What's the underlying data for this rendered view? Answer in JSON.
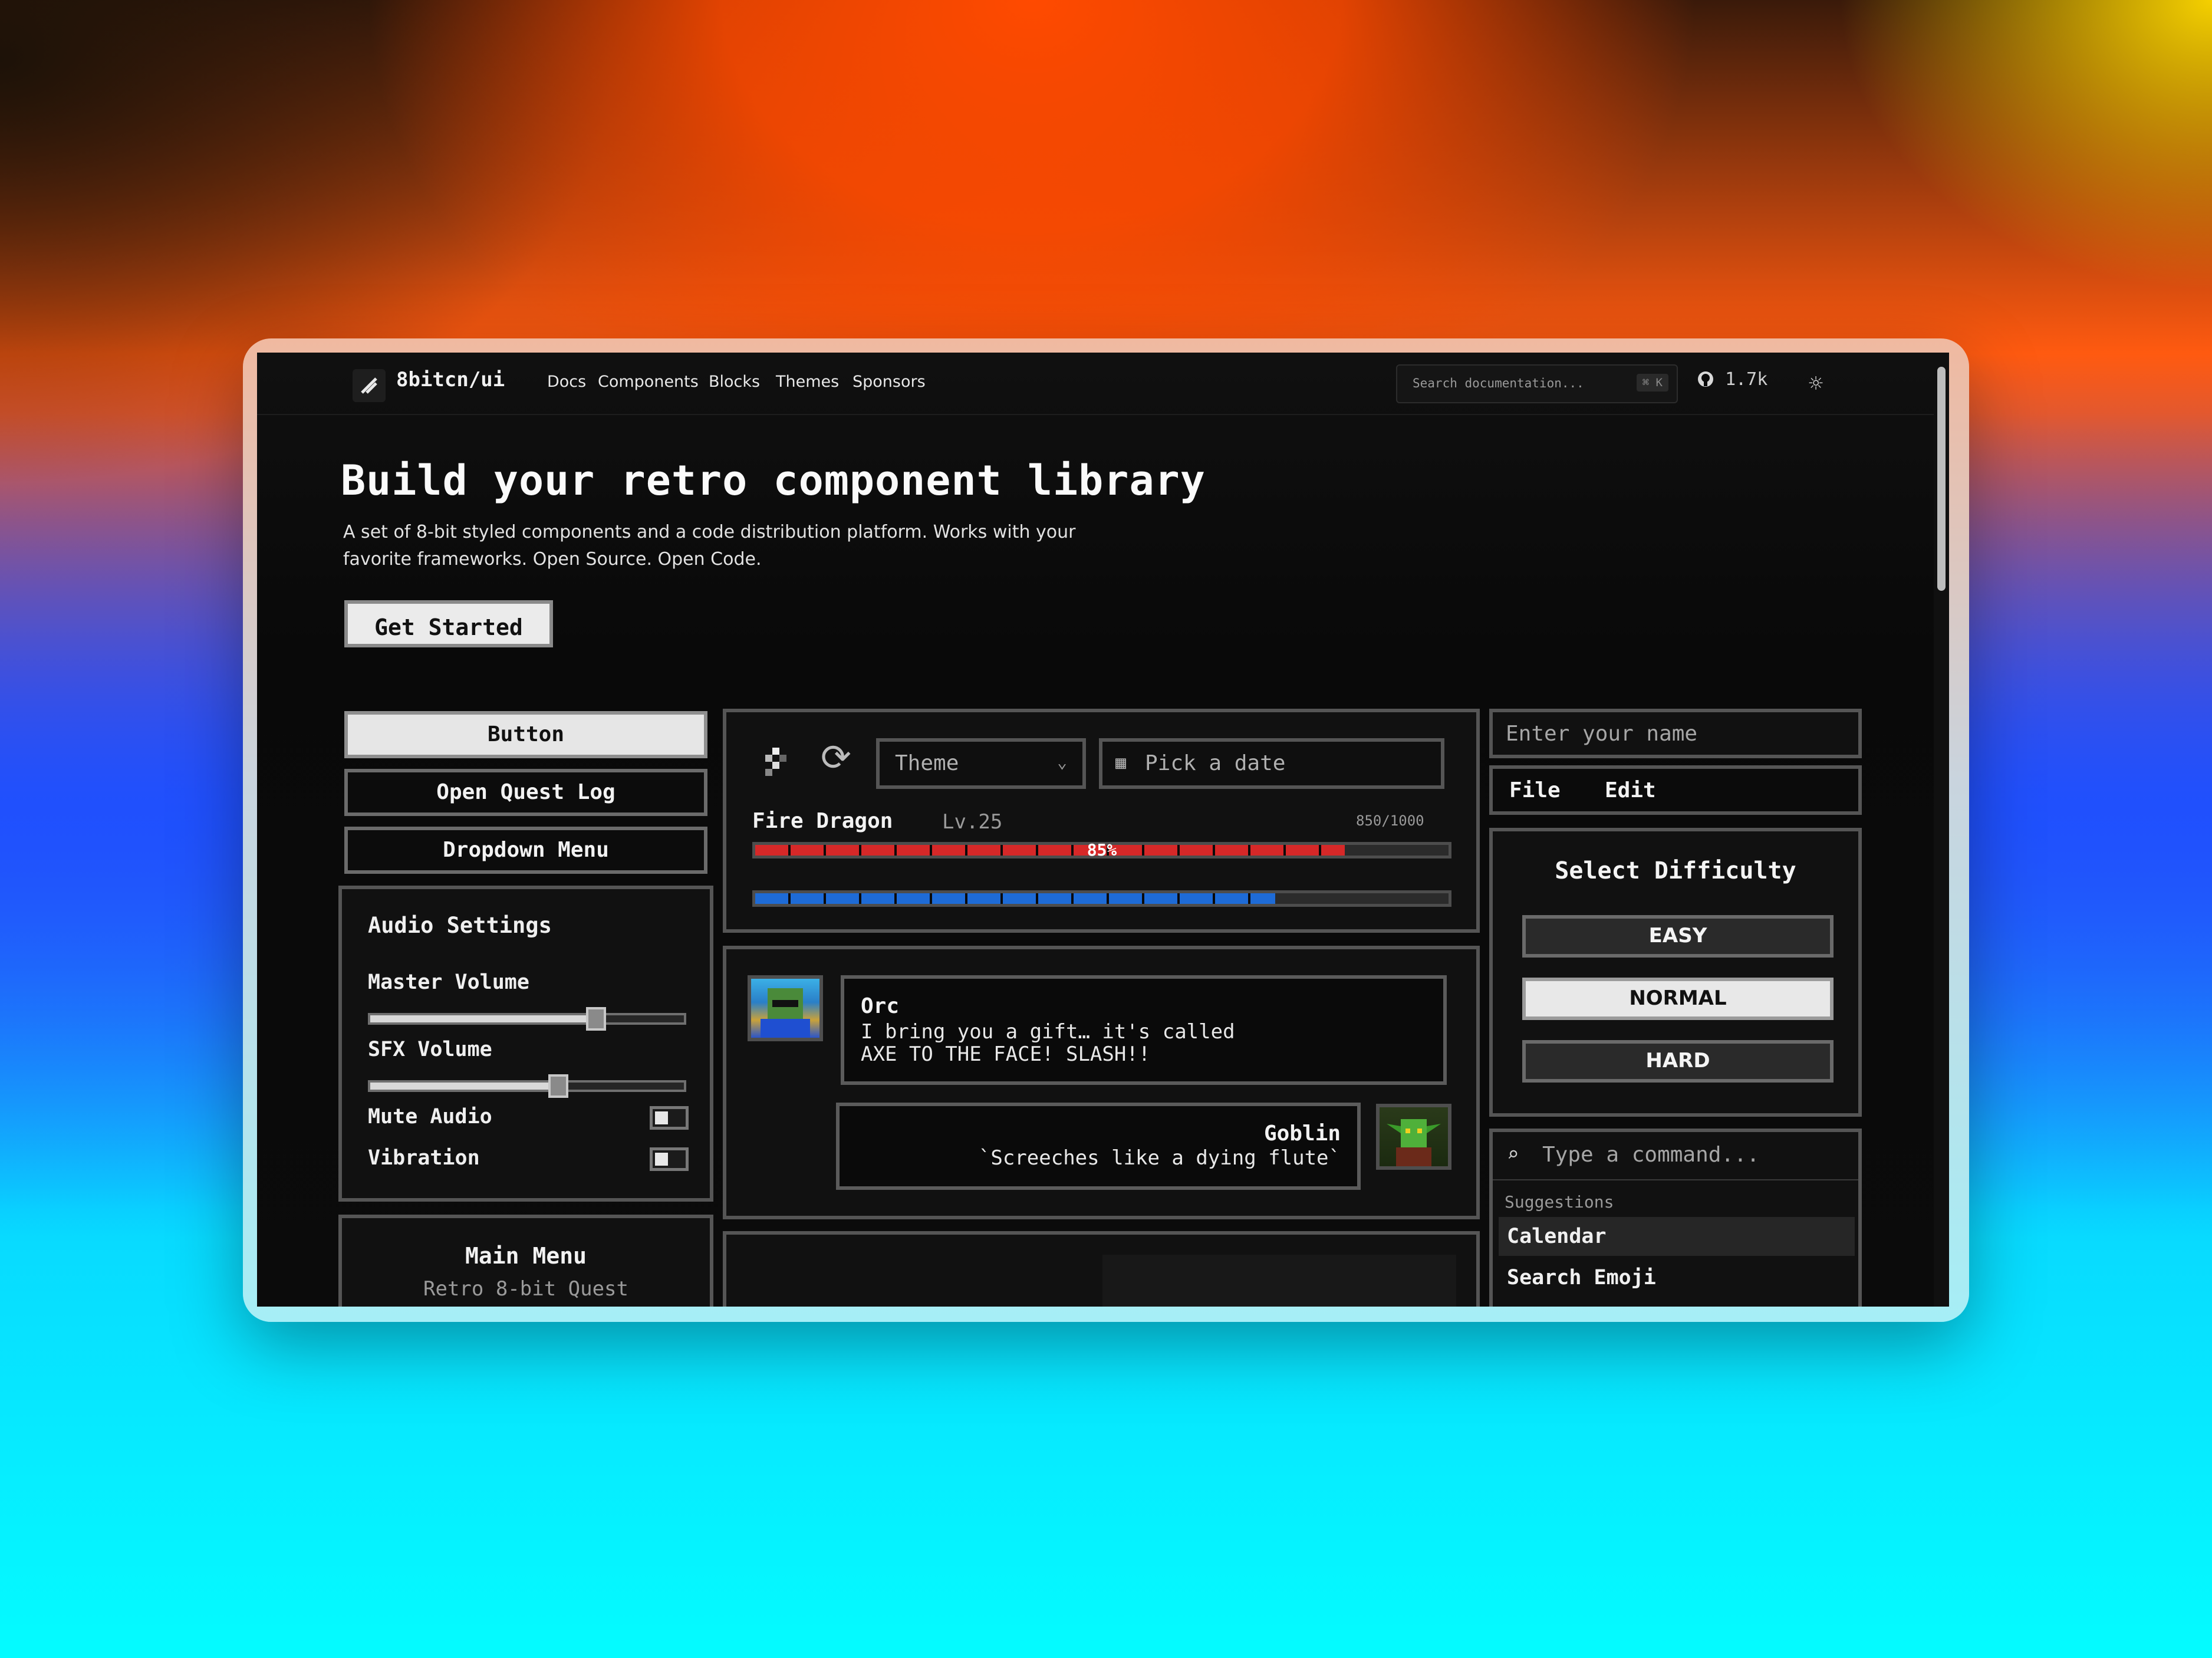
{
  "nav": {
    "logo": "8bitcn/ui",
    "links": [
      "Docs",
      "Components",
      "Blocks",
      "Themes",
      "Sponsors"
    ],
    "search_placeholder": "Search documentation...",
    "search_shortcut": "⌘ K",
    "github_stars": "1.7k"
  },
  "hero": {
    "title": "Build your retro component library",
    "description": "A set of 8-bit styled components and a code distribution platform. Works with your favorite frameworks. Open Source. Open Code.",
    "cta": "Get Started"
  },
  "left": {
    "buttons": [
      "Button",
      "Open Quest Log",
      "Dropdown Menu"
    ],
    "audio": {
      "title": "Audio Settings",
      "master_label": "Master Volume",
      "master_value": 0.72,
      "sfx_label": "SFX Volume",
      "sfx_value": 0.6,
      "mute_label": "Mute Audio",
      "mute_on": false,
      "vibration_label": "Vibration",
      "vibration_on": false
    },
    "main_menu": {
      "title": "Main Menu",
      "subtitle": "Retro 8-bit Quest"
    }
  },
  "center": {
    "theme_select": "Theme",
    "date_picker": "Pick a date",
    "boss": {
      "name": "Fire Dragon",
      "level": "Lv.25",
      "hp_text": "850/1000",
      "health_percent_label": "85%",
      "health_fraction": 0.85,
      "mana_fraction": 0.75,
      "health_color": "#d62828",
      "mana_color": "#1e6bd6"
    },
    "chat": {
      "orc_name": "Orc",
      "orc_line1": "I bring you a gift… it's called",
      "orc_line2": "AXE TO THE FACE! SLASH!!",
      "goblin_name": "Goblin",
      "goblin_line": "`Screeches like a dying flute`"
    }
  },
  "right": {
    "name_placeholder": "Enter your name",
    "menubar": [
      "File",
      "Edit"
    ],
    "difficulty": {
      "title": "Select Difficulty",
      "options": [
        "EASY",
        "NORMAL",
        "HARD"
      ],
      "selected": "NORMAL"
    },
    "command": {
      "placeholder": "Type a command...",
      "group_label": "Suggestions",
      "items": [
        "Calendar",
        "Search Emoji"
      ]
    }
  }
}
